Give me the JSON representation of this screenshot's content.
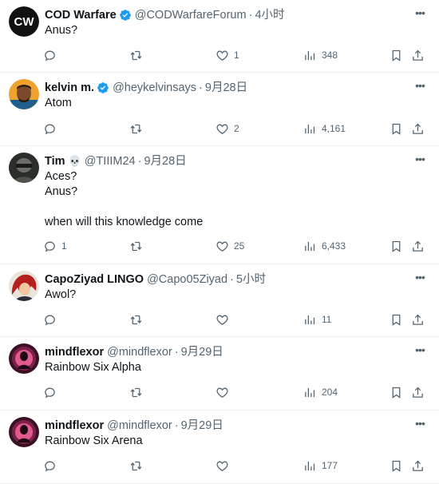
{
  "tweets": [
    {
      "name": "COD Warfare",
      "handle": "@CODWarfareForum",
      "time": "4小时",
      "verified": true,
      "emoji": "",
      "lines": [
        "Anus?"
      ],
      "replies": "",
      "retweets": "",
      "likes": "1",
      "views": "348",
      "avatar": "cw-logo"
    },
    {
      "name": "kelvin m.",
      "handle": "@heykelvinsays",
      "time": "9月28日",
      "verified": true,
      "emoji": "",
      "lines": [
        "Atom"
      ],
      "replies": "",
      "retweets": "",
      "likes": "2",
      "views": "4,161",
      "avatar": "person-photo"
    },
    {
      "name": "Tim",
      "handle": "@TIIIM24",
      "time": "9月28日",
      "verified": false,
      "emoji": "💀",
      "lines": [
        "Aces?",
        "Anus?",
        "",
        "when will this knowledge come"
      ],
      "replies": "1",
      "retweets": "",
      "likes": "25",
      "views": "6,433",
      "avatar": "soldier-photo"
    },
    {
      "name": "CapoZiyad LINGO",
      "handle": "@Capo05Ziyad",
      "time": "5小时",
      "verified": false,
      "emoji": "",
      "lines": [
        "Awol?"
      ],
      "replies": "",
      "retweets": "",
      "likes": "",
      "views": "11",
      "avatar": "anime-red-hair"
    },
    {
      "name": "mindflexor",
      "handle": "@mindflexor",
      "time": "9月29日",
      "verified": false,
      "emoji": "",
      "lines": [
        "Rainbow Six Alpha"
      ],
      "replies": "",
      "retweets": "",
      "likes": "",
      "views": "204",
      "avatar": "purple-figure"
    },
    {
      "name": "mindflexor",
      "handle": "@mindflexor",
      "time": "9月29日",
      "verified": false,
      "emoji": "",
      "lines": [
        "Rainbow Six Arena"
      ],
      "replies": "",
      "retweets": "",
      "likes": "",
      "views": "177",
      "avatar": "purple-figure"
    }
  ],
  "ui": {
    "dot": "·",
    "more": "•••",
    "avatar_text": "CW"
  },
  "colors": {
    "verified_blue": "#1d9bf0",
    "muted": "#536471",
    "text": "#0f1419",
    "divider": "#eff3f4"
  }
}
